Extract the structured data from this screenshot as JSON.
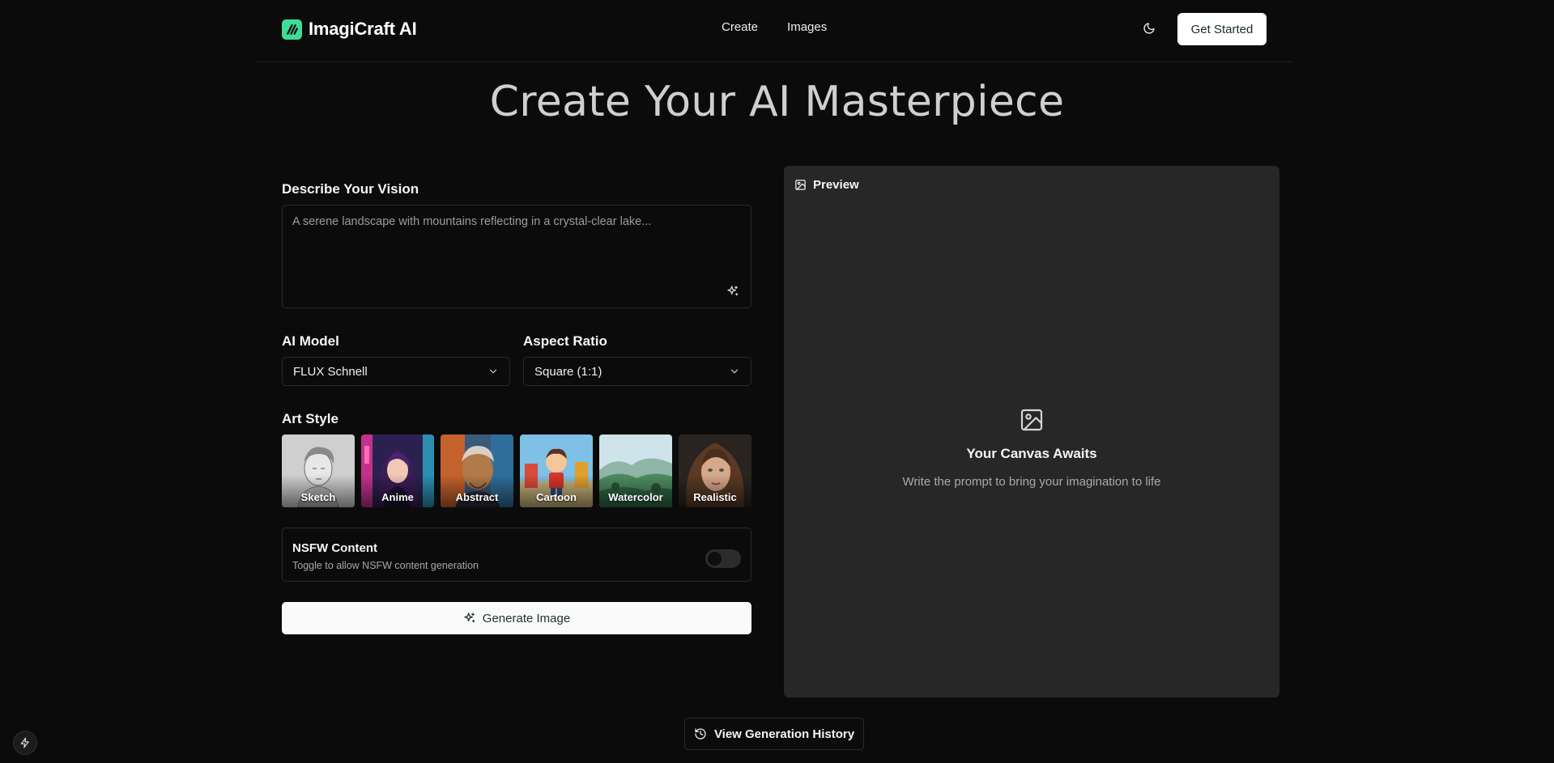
{
  "brand": {
    "name": "ImagiCraft AI",
    "logo_icon": "brand-logo-icon",
    "accent": "#3ddc97"
  },
  "nav": {
    "items": [
      {
        "label": "Create"
      },
      {
        "label": "Images"
      }
    ]
  },
  "header": {
    "theme_icon": "moon-icon",
    "cta_label": "Get Started"
  },
  "page": {
    "title": "Create Your AI Masterpiece"
  },
  "prompt": {
    "label": "Describe Your Vision",
    "value": "",
    "placeholder": "A serene landscape with mountains reflecting in a crystal-clear lake...",
    "enhance_icon": "sparkles-icon"
  },
  "model": {
    "label": "AI Model",
    "selected": "FLUX Schnell"
  },
  "aspect": {
    "label": "Aspect Ratio",
    "selected": "Square (1:1)"
  },
  "art_style": {
    "label": "Art Style",
    "items": [
      {
        "label": "Sketch"
      },
      {
        "label": "Anime"
      },
      {
        "label": "Abstract"
      },
      {
        "label": "Cartoon"
      },
      {
        "label": "Watercolor"
      },
      {
        "label": "Realistic"
      }
    ]
  },
  "nsfw": {
    "title": "NSFW Content",
    "description": "Toggle to allow NSFW content generation",
    "enabled": false
  },
  "generate": {
    "label": "Generate Image",
    "icon": "sparkles-icon"
  },
  "preview": {
    "label": "Preview",
    "empty_title": "Your Canvas Awaits",
    "empty_text": "Write the prompt to bring your imagination to life",
    "icon": "image-icon"
  },
  "history": {
    "label": "View Generation History",
    "icon": "history-icon"
  },
  "floating": {
    "icon": "bolt-icon"
  }
}
